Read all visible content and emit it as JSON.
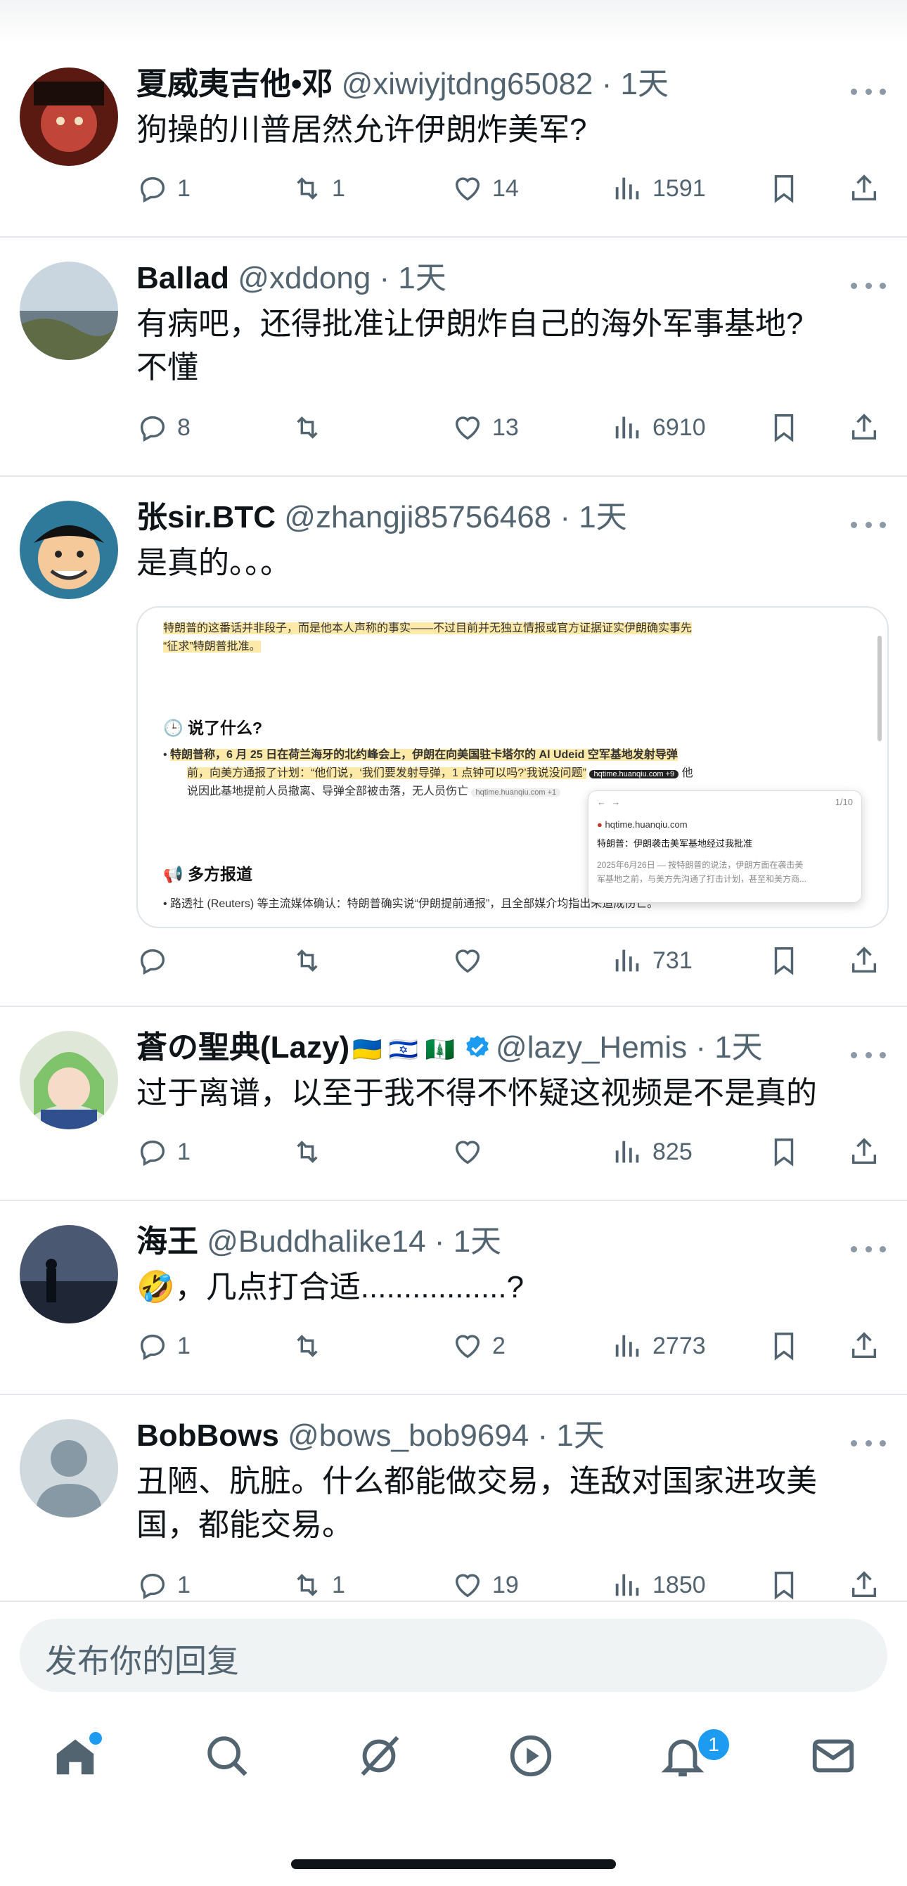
{
  "tweets": [
    {
      "name": "夏威夷吉他•邓",
      "handle": "@xiwiyjtdng65082",
      "time": "1天",
      "text": "狗操的川普居然允许伊朗炸美军?",
      "reply": "1",
      "retweet": "1",
      "like": "14",
      "views": "1591"
    },
    {
      "name": "Ballad",
      "handle": "@xddong",
      "time": "1天",
      "text": "有病吧，还得批准让伊朗炸自己的海外军事基地?",
      "text2": "不懂",
      "reply": "8",
      "retweet": "",
      "like": "13",
      "views": "6910"
    },
    {
      "name": "张sir.BTC",
      "handle": "@zhangji85756468",
      "time": "1天",
      "text": "是真的。。。",
      "reply": "",
      "retweet": "",
      "like": "",
      "views": "731"
    },
    {
      "name": "蒼の聖典(Lazy)",
      "flags": "🇺🇦 🇮🇱 🇳🇫",
      "handle": "@lazy_Hemis",
      "time": "1天",
      "text": "过于离谱，以至于我不得不怀疑这视频是不是真的",
      "reply": "1",
      "retweet": "",
      "like": "",
      "views": "825"
    },
    {
      "name": "海王",
      "handle": "@Buddhalike14",
      "time": "1天",
      "text": "🤣，几点打合适.................?",
      "reply": "1",
      "retweet": "",
      "like": "2",
      "views": "2773"
    },
    {
      "name": "BobBows",
      "handle": "@bows_bob9694",
      "time": "1天",
      "text": "丑陋、肮脏。什么都能做交易，连敌对国家进攻美",
      "text2": "国，都能交易。",
      "reply": "1",
      "retweet": "1",
      "like": "19",
      "views": "1850"
    }
  ],
  "embed": {
    "line1": "特朗普的这番话并非段子，而是他本人声称的事实——不过目前并无独立情报或官方证据证实伊朗确实事先",
    "line2": "“征求”特朗普批准。",
    "section1": "说了什么?",
    "b1a": "特朗普称，6 月 25 日在荷兰海牙的北约峰会上，伊朗在向美国驻卡塔尔的 Al Udeid 空军基地发射导弹",
    "b1b": "前，向美方通报了计划：“他们说，‘我们要发射导弹，1 点钟可以吗?’我说没问题”",
    "b1c": "说因此基地提前人员撤离、导弹全部被击落，无人员伤亡",
    "cite": "hqtime.huanqiu.com +9",
    "cite2": "hqtime.huanqiu.com +1",
    "he": "他",
    "section2": "多方报道",
    "b2": "路透社 (Reuters) 等主流媒体确认：特朗普确实说“伊朗提前通报”，且全部媒介均指出未造成伤亡。",
    "popup_counter": "1/10",
    "popup_site": "hqtime.huanqiu.com",
    "popup_title": "特朗普：伊朗袭击美军基地经过我批准",
    "popup_snip1": "2025年6月26日 — 按特朗普的说法，伊朗方面在袭击美",
    "popup_snip2": "军基地之前，与美方先沟通了打击计划，甚至和美方商..."
  },
  "reply_placeholder": "发布你的回复",
  "notif_badge": "1",
  "colors": {
    "accent": "#1d9bf0",
    "text": "#0f1419",
    "muted": "#536471"
  }
}
